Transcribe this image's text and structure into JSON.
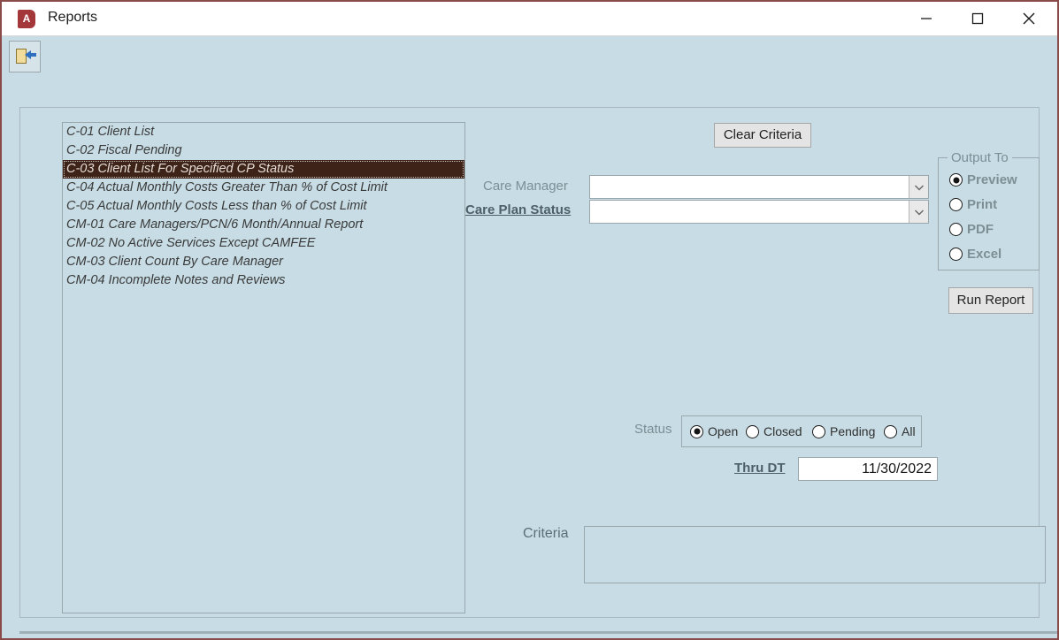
{
  "window": {
    "title": "Reports",
    "app_icon": "access-database-icon",
    "icon_letter": "A",
    "controls": {
      "minimize": "minimize-icon",
      "maximize": "maximize-icon",
      "close": "close-icon"
    }
  },
  "toolbar": {
    "exit_button": "exit-door-icon"
  },
  "report_list": {
    "items": [
      {
        "label": "C-01 Client List",
        "selected": false
      },
      {
        "label": "C-02 Fiscal Pending",
        "selected": false
      },
      {
        "label": "C-03 Client List For Specified CP Status",
        "selected": true
      },
      {
        "label": "C-04 Actual Monthly Costs Greater Than % of Cost Limit",
        "selected": false
      },
      {
        "label": "C-05 Actual Monthly Costs Less than % of Cost Limit",
        "selected": false
      },
      {
        "label": "CM-01 Care Managers/PCN/6 Month/Annual Report",
        "selected": false
      },
      {
        "label": "CM-02 No Active Services Except CAMFEE",
        "selected": false
      },
      {
        "label": "CM-03 Client Count By Care Manager",
        "selected": false
      },
      {
        "label": "CM-04 Incomplete Notes and Reviews",
        "selected": false
      }
    ]
  },
  "criteria_panel": {
    "clear_button": "Clear Criteria",
    "care_manager": {
      "label": "Care Manager",
      "value": "",
      "dropdown_icon": "chevron-down-icon"
    },
    "care_plan_status": {
      "label": "Care Plan Status",
      "value": "",
      "dropdown_icon": "chevron-down-icon"
    },
    "status": {
      "label": "Status",
      "options": [
        {
          "label": "Open",
          "selected": true
        },
        {
          "label": "Closed",
          "selected": false
        },
        {
          "label": "Pending",
          "selected": false
        },
        {
          "label": "All",
          "selected": false
        }
      ]
    },
    "thru_dt": {
      "label": "Thru DT",
      "value": "11/30/2022"
    },
    "criteria": {
      "label": "Criteria",
      "value": ""
    }
  },
  "output_to": {
    "caption": "Output To",
    "options": [
      {
        "label": "Preview",
        "selected": true
      },
      {
        "label": "Print",
        "selected": false
      },
      {
        "label": "PDF",
        "selected": false
      },
      {
        "label": "Excel",
        "selected": false
      }
    ],
    "run_button": "Run Report"
  },
  "colors": {
    "form_background": "#c7dce4",
    "selection": "#3d2318",
    "label_gray": "#7d8e95",
    "accent_red": "#a4373a",
    "border": "#9aa8ad"
  }
}
